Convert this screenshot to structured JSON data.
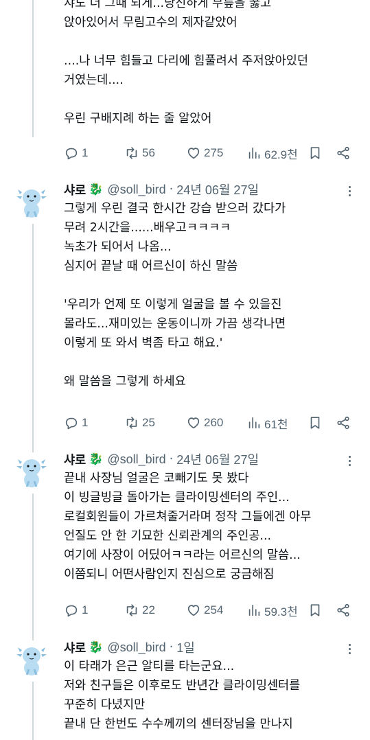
{
  "top_tweet": {
    "text": "샤도 더 그때 되게...당진하게 무릎을 꿇고\n앉아있어서 무림고수의 제자같았어\n\n....나 너무 힘들고 다리에 힘풀려서 주저앉아있던\n거였는데....\n\n우린 구배지례 하는 줄 알았어",
    "replies": "1",
    "retweets": "56",
    "likes": "275",
    "views": "62.9천"
  },
  "tweets": [
    {
      "name": "샤로",
      "emoji": "🐉",
      "handle": "@soll_bird",
      "time": "24년 06월 27일",
      "text": "그렇게 우린 결국 한시간 강습 받으러 갔다가\n무려 2시간을......배우고ㅋㅋㅋㅋ\n녹초가 되어서 나옴...\n심지어 끝날 때 어르신이 하신 말씀\n\n'우리가 언제 또 이렇게 얼굴을 볼 수 있을진\n몰라도...재미있는 운동이니까 가끔 생각나면\n이렇게 또 와서 벽좀 타고 해요.'\n\n왜 말씀을 그렇게 하세요",
      "replies": "1",
      "retweets": "25",
      "likes": "260",
      "views": "61천"
    },
    {
      "name": "샤로",
      "emoji": "🐉",
      "handle": "@soll_bird",
      "time": "24년 06월 27일",
      "text": "끝내 사장님 얼굴은 코빼기도 못 봤다\n이 빙글빙글 돌아가는 클라이밍센터의 주인...\n로컬회원들이 가르쳐줄거라며 정작 그들에겐 아무\n언질도 안 한 기묘한 신뢰관계의 주인공...\n여기에 사장이 어딨어ㅋㅋ라는 어르신의 말씀...\n이쯤되니 어떤사람인지 진심으로 궁금해짐",
      "replies": "1",
      "retweets": "22",
      "likes": "254",
      "views": "59.3천"
    },
    {
      "name": "샤로",
      "emoji": "🐉",
      "handle": "@soll_bird",
      "time": "1일",
      "text": "이 타래가 은근 알티를 타는군요...\n저와 친구들은 이후로도 반년간 클라이밍센터를\n꾸준히 다녔지만\n끝내 단 한번도 수수께끼의 센터장님을 만나지"
    }
  ]
}
